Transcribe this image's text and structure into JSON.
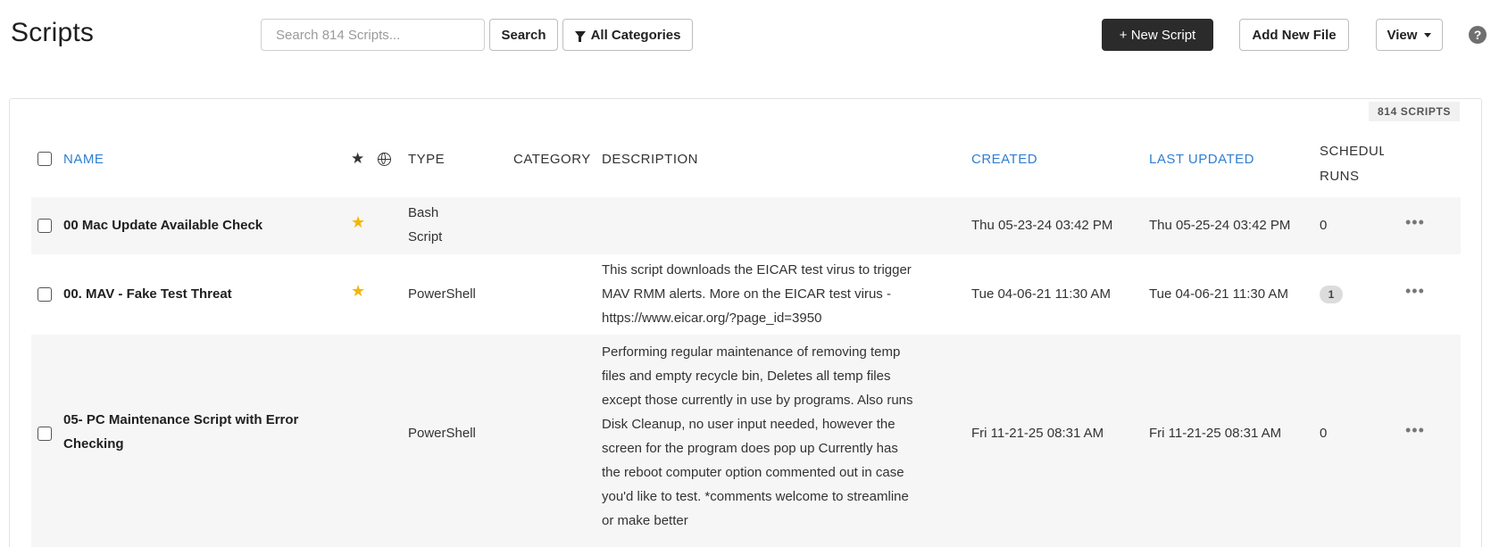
{
  "header": {
    "title": "Scripts",
    "search_placeholder": "Search 814 Scripts...",
    "search_button": "Search",
    "categories_button": "All Categories",
    "new_script_button": "+ New Script",
    "add_file_button": "Add New File",
    "view_button": "View",
    "help_label": "?"
  },
  "panel": {
    "count_badge": "814 SCRIPTS"
  },
  "table": {
    "columns": {
      "name": "NAME",
      "type": "TYPE",
      "category": "CATEGORY",
      "description": "DESCRIPTION",
      "created": "CREATED",
      "last_updated": "LAST UPDATED",
      "scheduled_runs_1": "SCHEDUL",
      "scheduled_runs_2": "RUNS"
    },
    "rows": [
      {
        "name_1": "00 Mac Update Available Check",
        "name_2": "",
        "starred": true,
        "type_1": "Bash",
        "type_2": "Script",
        "category": "",
        "description": [],
        "created": "Thu 05-23-24 03:42 PM",
        "last_updated": "Thu 05-25-24 03:42 PM",
        "runs": "0",
        "runs_badge": false
      },
      {
        "name_1": "00. MAV - Fake Test Threat",
        "name_2": "",
        "starred": true,
        "type_1": "PowerShell",
        "type_2": "",
        "category": "",
        "description": [
          "This script downloads the EICAR test virus to trigger",
          "MAV RMM alerts. More on the EICAR test virus -",
          "https://www.eicar.org/?page_id=3950"
        ],
        "created": "Tue 04-06-21 11:30 AM",
        "last_updated": "Tue 04-06-21 11:30 AM",
        "runs": "1",
        "runs_badge": true
      },
      {
        "name_1": "05- PC Maintenance Script with Error",
        "name_2": "Checking",
        "starred": false,
        "type_1": "PowerShell",
        "type_2": "",
        "category": "",
        "description": [
          "Performing regular maintenance of removing temp",
          "files and empty recycle bin, Deletes all temp files",
          "except those currently in use by programs. Also runs",
          "Disk Cleanup, no user input needed, however the",
          "screen for the program does pop up Currently has",
          "the reboot computer option commented out in case",
          "you'd like to test. *comments welcome to streamline",
          "or make better"
        ],
        "created": "Fri 11-21-25 08:31 AM",
        "last_updated": "Fri 11-21-25 08:31 AM",
        "runs": "0",
        "runs_badge": false
      }
    ]
  },
  "colors": {
    "accent_link": "#2f7fd1",
    "star_gold": "#f2b705",
    "primary_button": "#2b2b2b",
    "row_alt": "#f6f6f6"
  },
  "icons": [
    "filter-icon",
    "caret-down-icon",
    "help-icon",
    "star-icon",
    "globe-icon",
    "more-icon",
    "checkbox"
  ]
}
